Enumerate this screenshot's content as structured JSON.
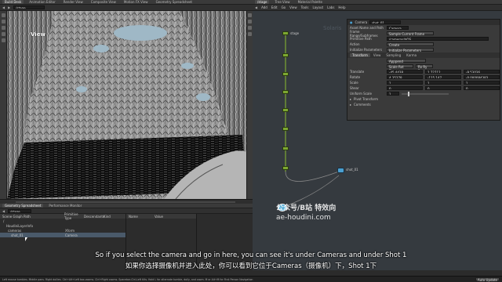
{
  "top_menu": {
    "tabs": [
      "Build Desk",
      "Animation Editor",
      "Render View",
      "Composite View",
      "Motion FX View",
      "Geometry Spreadsheet"
    ],
    "path": "/stage"
  },
  "viewport": {
    "label": "View"
  },
  "right_top": {
    "tabs": [
      "/stage",
      "Tree View",
      "Material Palette"
    ],
    "menu": [
      "Add",
      "Edit",
      "Go",
      "View",
      "Tools",
      "Layout",
      "Labs",
      "Help"
    ],
    "path": "/stage",
    "network_label": "Solaris"
  },
  "params": {
    "node_type": "Camera",
    "node_name": "shot_01",
    "rows": [
      {
        "label": "Asset Name and Path",
        "value": "Camera"
      },
      {
        "label": "Frame Range/Subframes",
        "value": "Sample Current Frame"
      },
      {
        "label": "Primitive Path",
        "value": "/cameras/$OS"
      },
      {
        "label": "Action",
        "value": "Create"
      },
      {
        "label": "Initialize Parameters",
        "value": "Initialize Parameters"
      }
    ],
    "tabs": [
      "Transform",
      "View",
      "Sampling",
      "Karma"
    ],
    "xform_mode": "Apppend",
    "xform_order": "Scale Rot Trans",
    "rot_order": "Rx Ry Rz",
    "vectors": [
      {
        "label": "Translate",
        "v": [
          "-45.4438",
          "1.72712",
          "-9.53036"
        ]
      },
      {
        "label": "Rotate",
        "v": [
          "4.35378",
          "-115.147",
          "-0.000084383"
        ]
      },
      {
        "label": "Scale",
        "v": [
          "1",
          "1",
          "1"
        ]
      },
      {
        "label": "Shear",
        "v": [
          "0",
          "0",
          "0"
        ]
      }
    ],
    "uniform_scale_label": "Uniform Scale",
    "uniform_scale": "1",
    "pivot": "Pivot Transform",
    "comments": "Comments"
  },
  "network_nodes": [
    {
      "name": "stage"
    },
    {
      "name": "shot_01"
    }
  ],
  "bottom_left": {
    "tabs": [
      "Geometry Spreadsheet",
      "Performance Monitor"
    ],
    "path": "/stage",
    "columns": [
      "Scene Graph Path",
      "Primitive Type",
      "Descendants",
      "Kind"
    ],
    "rows": [
      {
        "path": "/",
        "type": "",
        "kind": ""
      },
      {
        "path": "HoudiniLayerInfo",
        "type": "",
        "kind": ""
      },
      {
        "path": "cameras",
        "type": "Xform",
        "kind": ""
      },
      {
        "path": "shot_01",
        "type": "Camera",
        "kind": ""
      }
    ],
    "attr_columns": [
      "Name",
      "Value"
    ]
  },
  "watermark": {
    "line1": "公众号/B站 特效向",
    "line2": "ae-houdini.com"
  },
  "subtitles": {
    "en": "So if you select the camera and go in here, you can see it's under Cameras and under Shot 1",
    "zh": "如果你选择摄像机并进入此处，你可以看到它位于Cameras（摄像机）下，Shot 1下"
  },
  "status_bar": {
    "left": "Left mouse tumbles. Middle pans. Right dollies. Ctrl+Alt+Left box-zooms. Ctrl+Right zooms. Spacebar-Ctrl-Left tilts. Hold L for alternate tumble, dolly, and zoom. M or Alt+M for First Person Navigation",
    "right": "Auto Update"
  },
  "colors": {
    "node_green": "#7da832",
    "node_blue": "#4a9fd0",
    "accent": "#e8a040"
  }
}
